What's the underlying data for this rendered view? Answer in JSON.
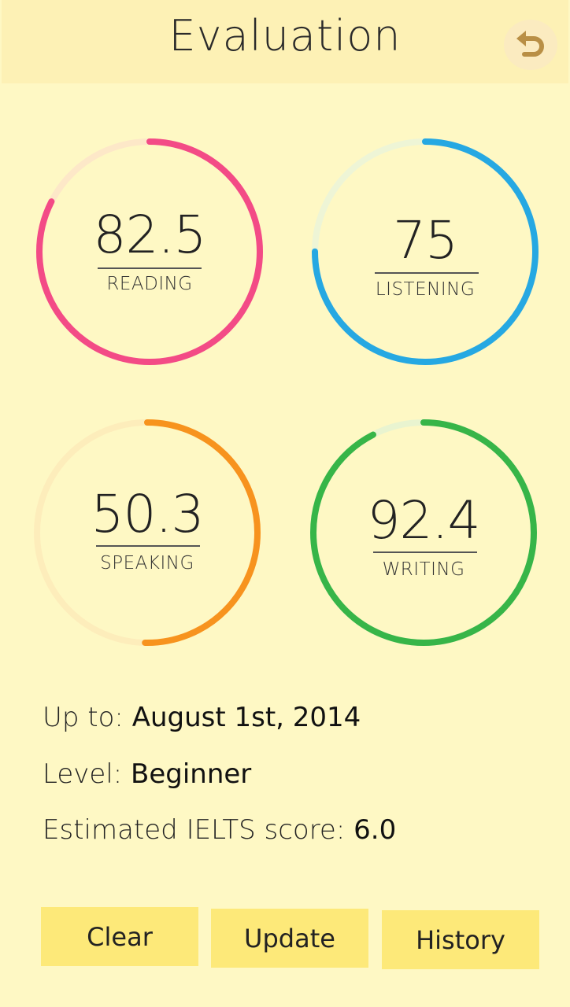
{
  "header": {
    "title": "Evaluation"
  },
  "scores": [
    {
      "value": "82.5",
      "label": "READING",
      "percent": 82.5,
      "color": "#F34B86",
      "track": "#FDE8C8"
    },
    {
      "value": "75",
      "label": "LISTENING",
      "percent": 75,
      "color": "#26A8E2",
      "track": "#EEF5D6"
    },
    {
      "value": "50.3",
      "label": "SPEAKING",
      "percent": 50.3,
      "color": "#F7931E",
      "track": "#FDEDBB"
    },
    {
      "value": "92.4",
      "label": "WRITING",
      "percent": 92.4,
      "color": "#37B548",
      "track": "#E9F4D0"
    }
  ],
  "info": {
    "up_to_label": "Up to:",
    "up_to_value": "August 1st, 2014",
    "level_label": "Level:",
    "level_value": "Beginner",
    "ielts_label": "Estimated IELTS score:",
    "ielts_value": "6.0"
  },
  "buttons": {
    "clear": "Clear",
    "update": "Update",
    "history": "History"
  },
  "colors": {
    "background": "#FEF8C4",
    "header": "#FDF1B5",
    "button": "#FDE979",
    "back_icon": "#B98F45"
  },
  "icons": {
    "back": "undo-arrow-icon"
  }
}
